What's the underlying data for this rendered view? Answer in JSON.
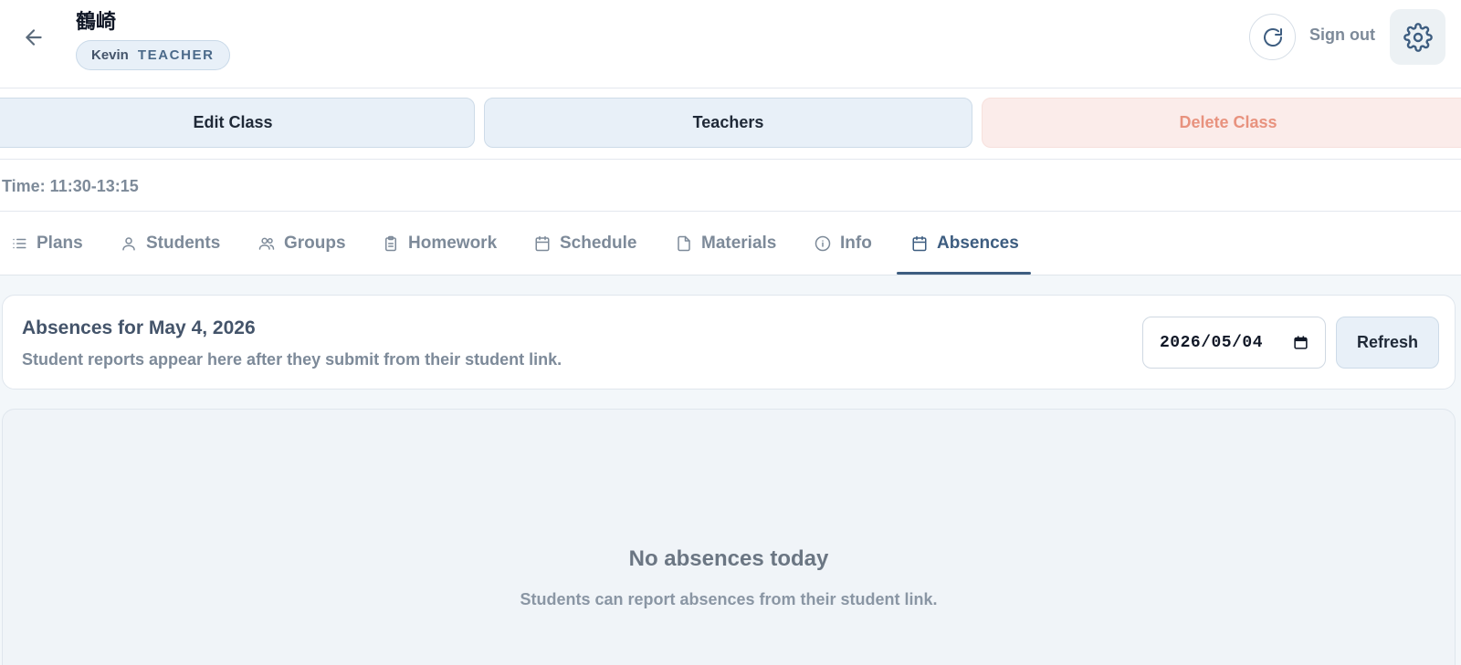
{
  "header": {
    "class_title": "鶴崎",
    "user_name": "Kevin",
    "user_role": "TEACHER",
    "sign_out_label": "Sign out",
    "icons": {
      "back": "arrow-left-icon",
      "refresh": "refresh-icon",
      "settings": "gear-icon"
    }
  },
  "actions": {
    "edit_label": "Edit Class",
    "teachers_label": "Teachers",
    "delete_label": "Delete Class"
  },
  "class_info": {
    "time_text": "Time: 11:30-13:15"
  },
  "tabs": [
    {
      "label": "Plans",
      "icon": "list-icon",
      "active": false
    },
    {
      "label": "Students",
      "icon": "user-icon",
      "active": false
    },
    {
      "label": "Groups",
      "icon": "users-icon",
      "active": false
    },
    {
      "label": "Homework",
      "icon": "clipboard-icon",
      "active": false
    },
    {
      "label": "Schedule",
      "icon": "calendar-icon",
      "active": false
    },
    {
      "label": "Materials",
      "icon": "file-icon",
      "active": false
    },
    {
      "label": "Info",
      "icon": "info-icon",
      "active": false
    },
    {
      "label": "Absences",
      "icon": "calendar-icon",
      "active": true
    }
  ],
  "absences": {
    "title": "Absences for May 4, 2026",
    "subtitle": "Student reports appear here after they submit from their student link.",
    "date_value": "2026/05/04",
    "refresh_label": "Refresh",
    "empty_title": "No absences today",
    "empty_subtitle": "Students can report absences from their student link."
  },
  "colors": {
    "accent": "#3d5d80",
    "danger_text": "#e8927e",
    "danger_bg": "#fbecea",
    "muted_text": "#7d8a99",
    "button_bg": "#e8f0f8"
  }
}
